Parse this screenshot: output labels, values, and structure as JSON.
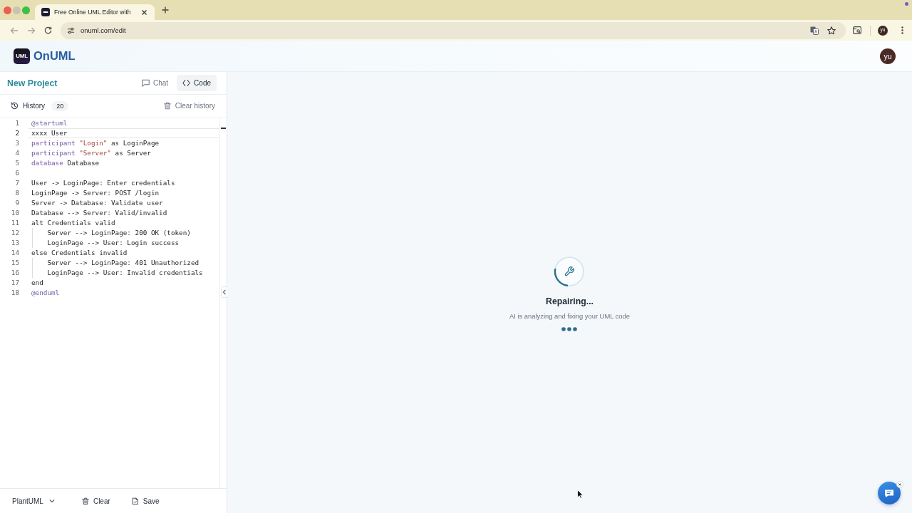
{
  "browser": {
    "tab": {
      "title": "Free Online UML Editor with"
    },
    "url": "onuml.com/edit",
    "profile": "yu"
  },
  "app": {
    "logo_badge": "UML",
    "name": "OnUML",
    "avatar": "yu"
  },
  "panel": {
    "project": "New Project",
    "tabs": [
      {
        "label": "Chat",
        "selected": false
      },
      {
        "label": "Code",
        "selected": true
      }
    ],
    "history": {
      "label": "History",
      "count": "20",
      "clear": "Clear history"
    },
    "editor": {
      "lines": [
        {
          "number": "1",
          "active": false,
          "segments": [
            {
              "text": "@startuml",
              "kind": "directive"
            }
          ]
        },
        {
          "number": "2",
          "active": true,
          "segments": [
            {
              "text": "xxxx User",
              "kind": "plain"
            }
          ]
        },
        {
          "number": "3",
          "active": false,
          "segments": [
            {
              "text": "participant ",
              "kind": "keyword"
            },
            {
              "text": "\"Login\"",
              "kind": "string"
            },
            {
              "text": " as LoginPage",
              "kind": "plain"
            }
          ]
        },
        {
          "number": "4",
          "active": false,
          "segments": [
            {
              "text": "participant ",
              "kind": "keyword"
            },
            {
              "text": "\"Server\"",
              "kind": "string"
            },
            {
              "text": " as Server",
              "kind": "plain"
            }
          ]
        },
        {
          "number": "5",
          "active": false,
          "segments": [
            {
              "text": "database",
              "kind": "keyword"
            },
            {
              "text": " Database",
              "kind": "plain"
            }
          ]
        },
        {
          "number": "6",
          "active": false
        },
        {
          "number": "7",
          "active": false,
          "segments": [
            {
              "text": "User -> LoginPage: Enter credentials",
              "kind": "plain"
            }
          ]
        },
        {
          "number": "8",
          "active": false,
          "segments": [
            {
              "text": "LoginPage -> Server: POST /login",
              "kind": "plain"
            }
          ]
        },
        {
          "number": "9",
          "active": false,
          "segments": [
            {
              "text": "Server -> Database: Validate user",
              "kind": "plain"
            }
          ]
        },
        {
          "number": "10",
          "active": false,
          "segments": [
            {
              "text": "Database --> Server: Valid/invalid",
              "kind": "plain"
            }
          ]
        },
        {
          "number": "11",
          "active": false,
          "segments": [
            {
              "text": "alt Credentials valid",
              "kind": "plain"
            }
          ],
          "children": [
            {
              "number": "12",
              "active": false,
              "segments": [
                {
                  "text": "Server --> LoginPage: 200 OK (token)",
                  "kind": "plain"
                }
              ]
            },
            {
              "number": "13",
              "active": false,
              "segments": [
                {
                  "text": "LoginPage --> User: Login success",
                  "kind": "plain"
                }
              ]
            }
          ]
        },
        {
          "number": "14",
          "active": false,
          "segments": [
            {
              "text": "else Credentials invalid",
              "kind": "plain"
            }
          ],
          "children": [
            {
              "number": "15",
              "active": false,
              "segments": [
                {
                  "text": "Server --> LoginPage: 401 Unauthorized",
                  "kind": "plain"
                }
              ]
            },
            {
              "number": "16",
              "active": false,
              "segments": [
                {
                  "text": "LoginPage --> User: Invalid credentials",
                  "kind": "plain"
                }
              ]
            }
          ]
        },
        {
          "number": "17",
          "active": false,
          "segments": [
            {
              "text": "end",
              "kind": "plain"
            }
          ]
        },
        {
          "number": "18",
          "active": false,
          "segments": [
            {
              "text": "@enduml",
              "kind": "directive"
            }
          ]
        }
      ]
    },
    "footer": {
      "language": "PlantUML",
      "buttons": [
        {
          "label": "Clear"
        },
        {
          "label": "Save"
        }
      ]
    }
  },
  "preview": {
    "status": {
      "title": "Repairing...",
      "message": "AI is analyzing and fixing your UML code"
    }
  }
}
